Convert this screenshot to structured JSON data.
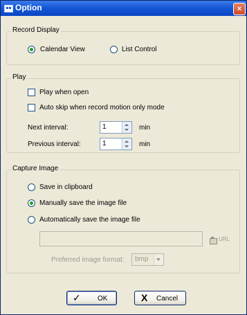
{
  "window": {
    "title": "Option",
    "close_glyph": "×",
    "title_icon": "app-icon"
  },
  "record_display": {
    "legend": "Record Display",
    "options": [
      {
        "label": "Calendar View",
        "selected": true
      },
      {
        "label": "List Control",
        "selected": false
      }
    ]
  },
  "play": {
    "legend": "Play",
    "play_when_open": {
      "label": "Play when open",
      "checked": false
    },
    "auto_skip": {
      "label": "Auto skip when record motion only mode",
      "checked": false
    },
    "next_interval": {
      "label": "Next interval:",
      "value": "1",
      "unit": "min"
    },
    "previous_interval": {
      "label": "Previous interval:",
      "value": "1",
      "unit": "min"
    }
  },
  "capture_image": {
    "legend": "Capture Image",
    "options": [
      {
        "label": "Save in clipboard",
        "selected": false
      },
      {
        "label": "Manually save the image file",
        "selected": true
      },
      {
        "label": "Automatically save the image file",
        "selected": false
      }
    ],
    "path": {
      "value": "",
      "browse_icon": "folder-icon",
      "browse_label": "URL"
    },
    "format": {
      "label": "Preferred image format:",
      "value": "bmp"
    }
  },
  "buttons": {
    "ok": {
      "label": "OK",
      "icon": "checkmark-icon",
      "glyph": "✓"
    },
    "cancel": {
      "label": "Cancel",
      "icon": "x-icon",
      "glyph": "X"
    }
  },
  "colors": {
    "titlebar": "#1658d6",
    "dialog_bg": "#ece9d8",
    "radio_dot": "#21a121",
    "disabled_text": "#9b9b8c"
  }
}
